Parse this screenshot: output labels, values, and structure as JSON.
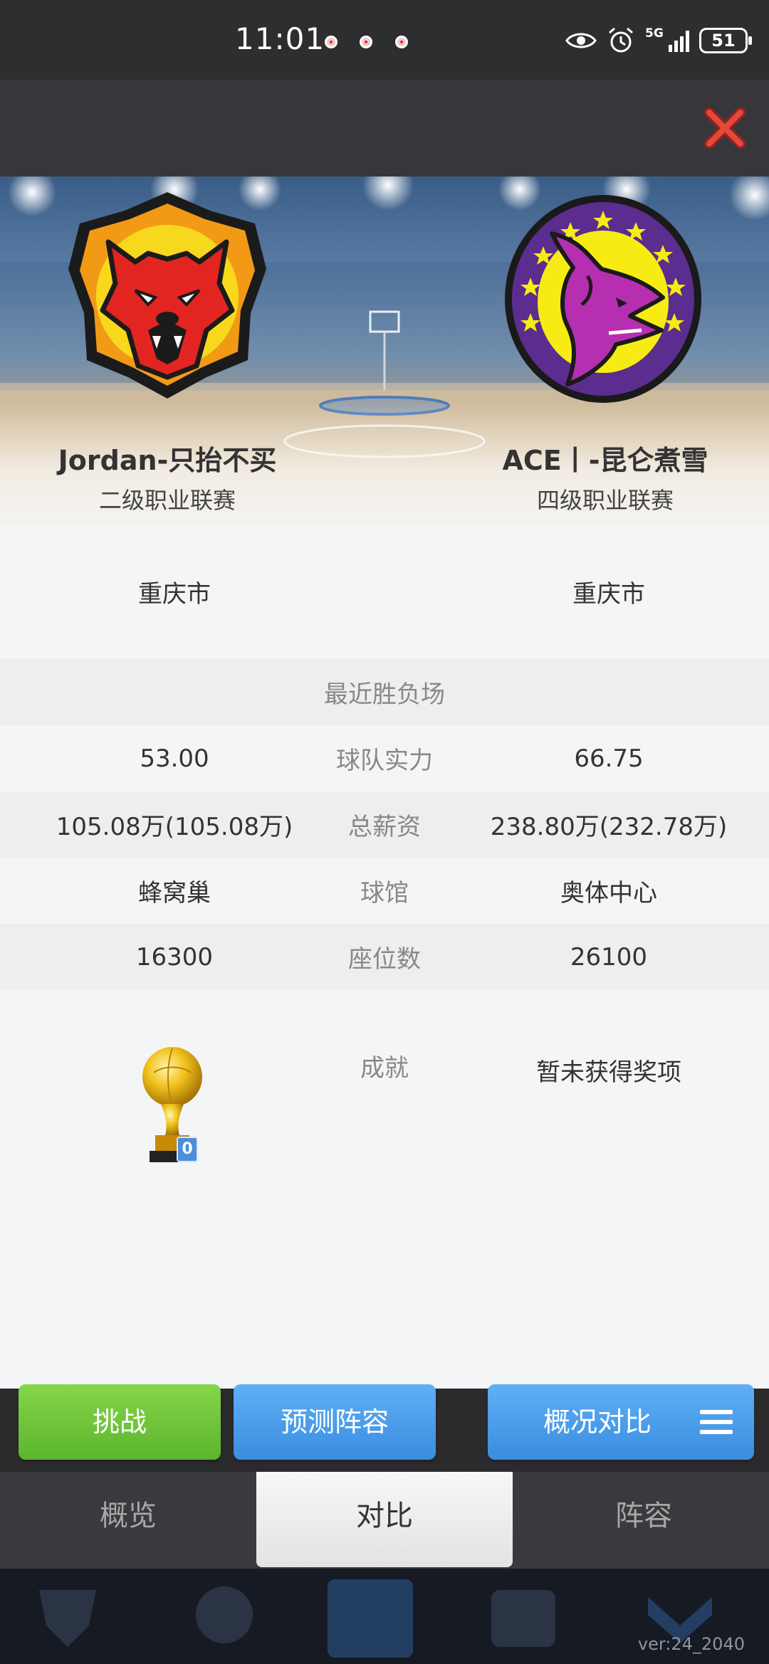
{
  "status_bar": {
    "time": "11:01",
    "network": "5G",
    "battery": "51",
    "icons": [
      "notification-icon",
      "notification-icon",
      "notification-icon",
      "eye-icon",
      "alarm-icon",
      "signal-icon",
      "battery-icon"
    ]
  },
  "header": {
    "close_icon": "close-icon"
  },
  "teams": {
    "left": {
      "name": "Jordan-只抬不买",
      "league": "二级职业联赛",
      "logo": "wolf-logo"
    },
    "right": {
      "name": "ACE丨-昆仑煮雪",
      "league": "四级职业联赛",
      "logo": "dragon-logo"
    }
  },
  "compare": {
    "city": {
      "left": "重庆市",
      "right": "重庆市"
    },
    "recent_header": "最近胜负场",
    "rows": [
      {
        "label": "球队实力",
        "left": "53.00",
        "right": "66.75"
      },
      {
        "label": "总薪资",
        "left": "105.08万(105.08万)",
        "right": "238.80万(232.78万)"
      },
      {
        "label": "球馆",
        "left": "蜂窝巢",
        "right": "奥体中心"
      },
      {
        "label": "座位数",
        "left": "16300",
        "right": "26100"
      }
    ],
    "achievement": {
      "label": "成就",
      "left_trophy_count": "0",
      "right": "暂未获得奖项"
    }
  },
  "buttons": {
    "challenge": "挑战",
    "predict": "预测阵容",
    "overview_compare": "概况对比"
  },
  "tabs": {
    "overview": "概览",
    "compare": "对比",
    "lineup": "阵容",
    "active": "compare"
  },
  "version": "ver:24_2040",
  "colors": {
    "green": "#5cb42e",
    "blue": "#3a8de0",
    "header": "#37373b"
  }
}
